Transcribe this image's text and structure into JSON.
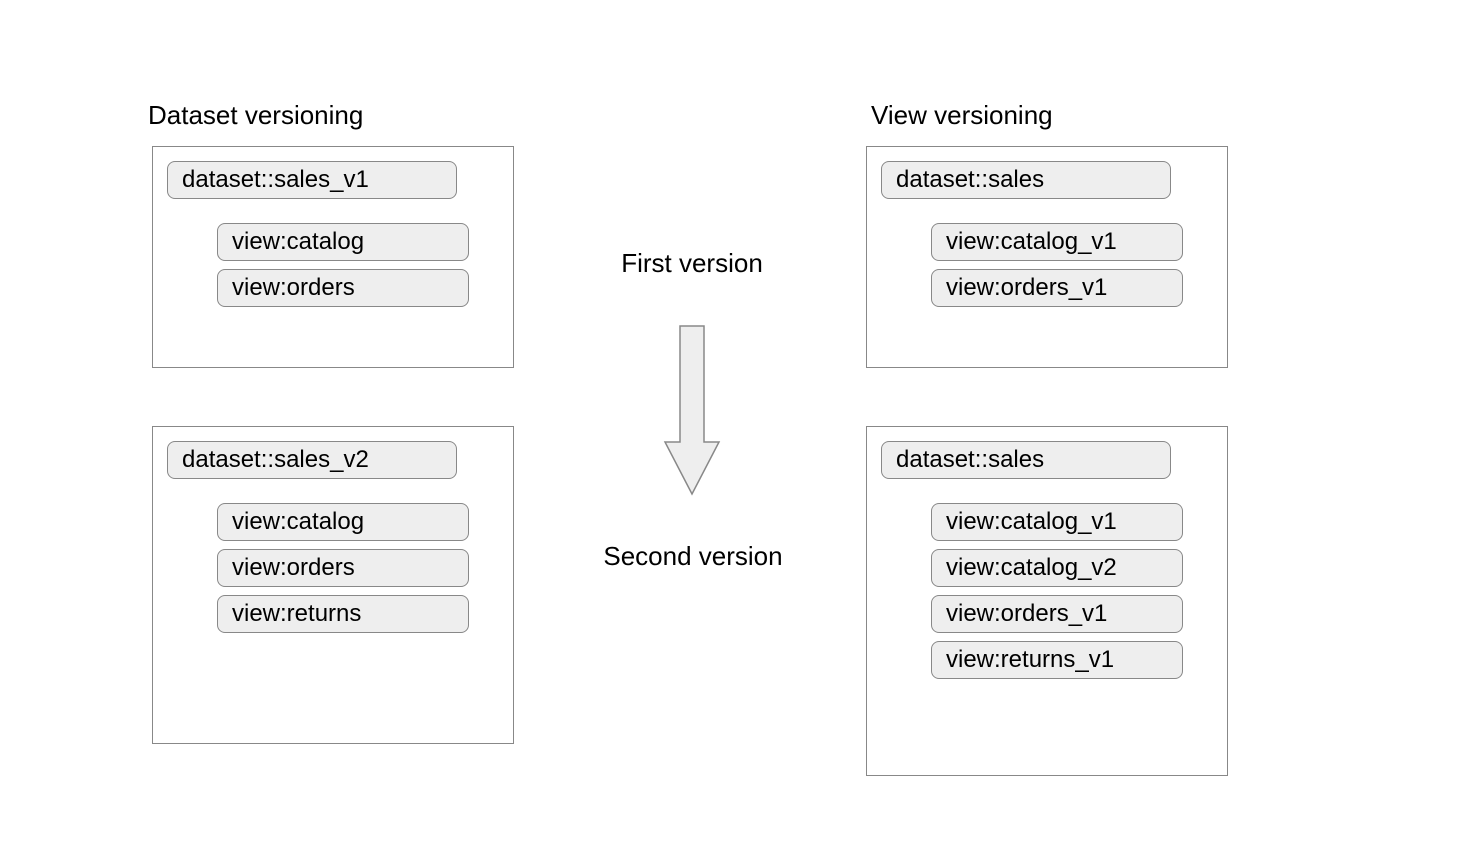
{
  "titles": {
    "left": "Dataset versioning",
    "right": "View versioning"
  },
  "center": {
    "first": "First version",
    "second": "Second version"
  },
  "left": {
    "panel1": {
      "dataset": "dataset::sales_v1",
      "views": [
        "view:catalog",
        "view:orders"
      ]
    },
    "panel2": {
      "dataset": "dataset::sales_v2",
      "views": [
        "view:catalog",
        "view:orders",
        "view:returns"
      ]
    }
  },
  "right": {
    "panel1": {
      "dataset": "dataset::sales",
      "views": [
        "view:catalog_v1",
        "view:orders_v1"
      ]
    },
    "panel2": {
      "dataset": "dataset::sales",
      "views": [
        "view:catalog_v1",
        "view:catalog_v2",
        "view:orders_v1",
        "view:returns_v1"
      ]
    }
  },
  "colors": {
    "pill_bg": "#eeeeee",
    "border": "#888888"
  }
}
